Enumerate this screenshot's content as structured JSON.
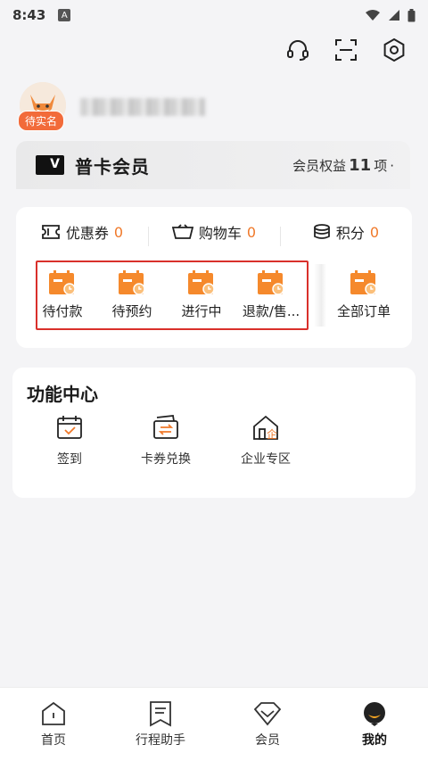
{
  "status_bar": {
    "time": "8:43",
    "a_badge": "A"
  },
  "header": {
    "icons": [
      "headset-icon",
      "scan-icon",
      "settings-icon"
    ]
  },
  "profile": {
    "verify_tag": "待实名"
  },
  "member": {
    "title": "普卡会员",
    "rights_prefix": "会员权益",
    "rights_count": "11",
    "rights_suffix": "项",
    "logo_letter": "V"
  },
  "stats": [
    {
      "label": "优惠券",
      "value": "0"
    },
    {
      "label": "购物车",
      "value": "0"
    },
    {
      "label": "积分",
      "value": "0"
    }
  ],
  "orders": [
    {
      "label": "待付款"
    },
    {
      "label": "待预约"
    },
    {
      "label": "进行中"
    },
    {
      "label": "退款/售..."
    },
    {
      "label": "全部订单"
    }
  ],
  "functions": {
    "title": "功能中心",
    "items": [
      {
        "label": "签到"
      },
      {
        "label": "卡券兑换"
      },
      {
        "label": "企业专区",
        "badge": "企"
      }
    ]
  },
  "nav": [
    {
      "label": "首页"
    },
    {
      "label": "行程助手"
    },
    {
      "label": "会员"
    },
    {
      "label": "我的"
    }
  ],
  "colors": {
    "accent": "#f0792a",
    "highlight_box": "#d9302b",
    "tag": "#f26b3a"
  }
}
